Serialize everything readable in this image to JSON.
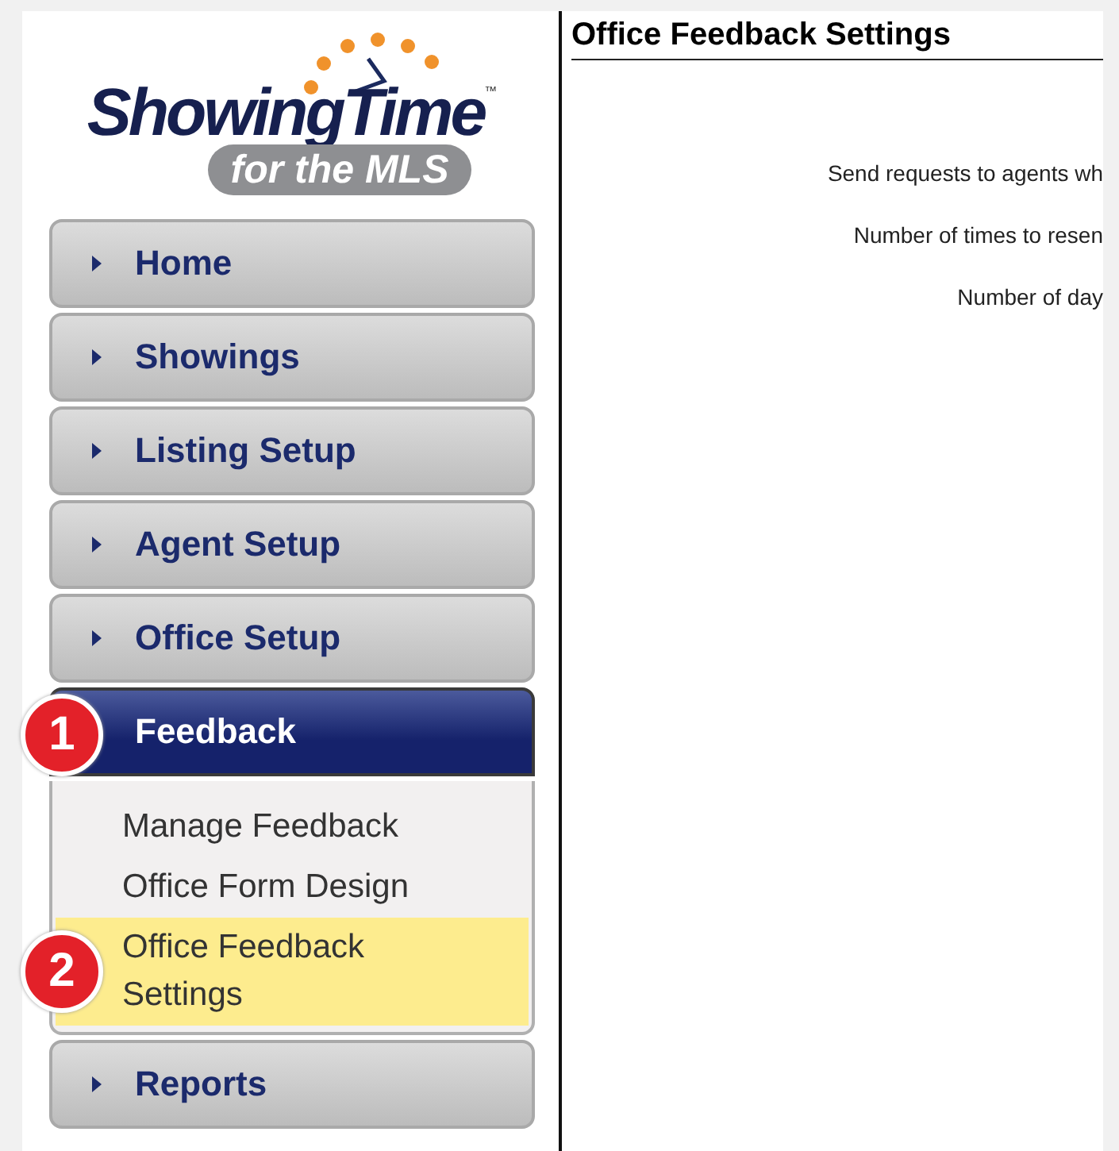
{
  "logo": {
    "name": "ShowingTime",
    "trademark": "™",
    "tagline": "for the MLS"
  },
  "nav": [
    {
      "label": "Home",
      "selected": false,
      "expanded": false
    },
    {
      "label": "Showings",
      "selected": false,
      "expanded": false
    },
    {
      "label": "Listing Setup",
      "selected": false,
      "expanded": false
    },
    {
      "label": "Agent Setup",
      "selected": false,
      "expanded": false
    },
    {
      "label": "Office Setup",
      "selected": false,
      "expanded": false
    },
    {
      "label": "Feedback",
      "selected": true,
      "expanded": true,
      "badge": "1",
      "children": [
        {
          "label": "Manage Feedback",
          "selected": false
        },
        {
          "label": "Office Form Design",
          "selected": false
        },
        {
          "label": "Office Feedback Settings",
          "selected": true,
          "badge": "2"
        }
      ]
    },
    {
      "label": "Reports",
      "selected": false,
      "expanded": false
    }
  ],
  "content": {
    "title": "Office Feedback Settings",
    "fields": [
      {
        "label": "Send requests to agents wh"
      },
      {
        "label": "Number of times to resen"
      },
      {
        "label": "Number of day"
      }
    ]
  }
}
